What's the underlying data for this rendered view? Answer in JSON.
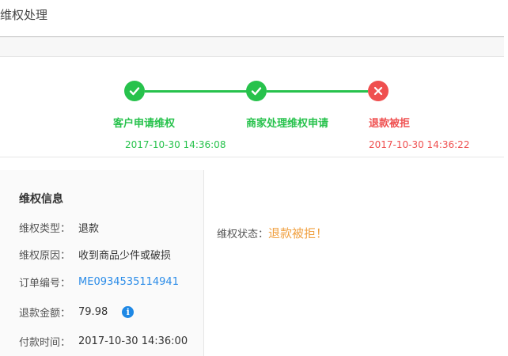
{
  "page": {
    "title": "维权处理"
  },
  "steps": [
    {
      "label": "客户申请维权",
      "time": "2017-10-30 14:36:08",
      "status": "done",
      "icon": "check-icon"
    },
    {
      "label": "商家处理维权申请",
      "time": "",
      "status": "done",
      "icon": "check-icon"
    },
    {
      "label": "退款被拒",
      "time": "2017-10-30 14:36:22",
      "status": "rejected",
      "icon": "close-icon"
    }
  ],
  "info": {
    "heading": "维权信息",
    "type_label": "维权类型：",
    "type_value": "退款",
    "reason_label": "维权原因：",
    "reason_value": "收到商品少件或破损",
    "order_label": "订单编号：",
    "order_value": "ME0934535114941",
    "amount_label": "退款金额：",
    "amount_value": "79.98",
    "paytime_label": "付款时间：",
    "paytime_value": "2017-10-30 14:36:00",
    "info_icon_glyph": "i"
  },
  "status": {
    "label": "维权状态：",
    "value": "退款被拒！"
  },
  "colors": {
    "success": "#27c24c",
    "danger": "#ef4f4f",
    "link": "#2b8ce8",
    "warning": "#f0a040",
    "info": "#1e88e5"
  }
}
